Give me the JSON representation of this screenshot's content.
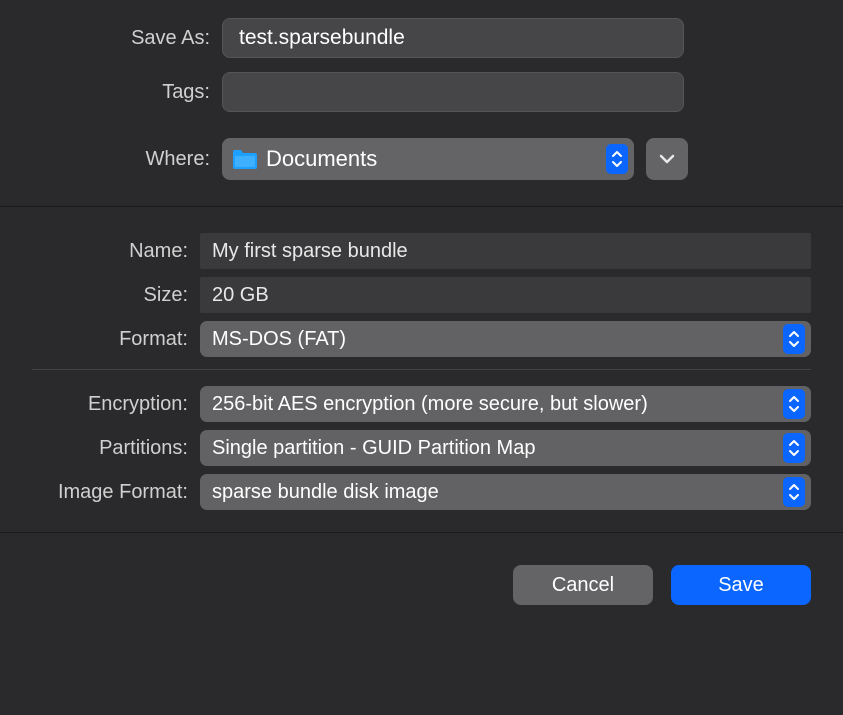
{
  "top": {
    "saveAsLabel": "Save As:",
    "saveAsValue": "test.sparsebundle",
    "tagsLabel": "Tags:",
    "tagsValue": "",
    "whereLabel": "Where:",
    "whereValue": "Documents"
  },
  "mid": {
    "nameLabel": "Name:",
    "nameValue": "My first sparse bundle",
    "sizeLabel": "Size:",
    "sizeValue": "20 GB",
    "formatLabel": "Format:",
    "formatValue": "MS-DOS (FAT)",
    "encryptionLabel": "Encryption:",
    "encryptionValue": "256-bit AES encryption (more secure, but slower)",
    "partitionsLabel": "Partitions:",
    "partitionsValue": "Single partition - GUID Partition Map",
    "imageFormatLabel": "Image Format:",
    "imageFormatValue": "sparse bundle disk image"
  },
  "buttons": {
    "cancel": "Cancel",
    "save": "Save"
  }
}
